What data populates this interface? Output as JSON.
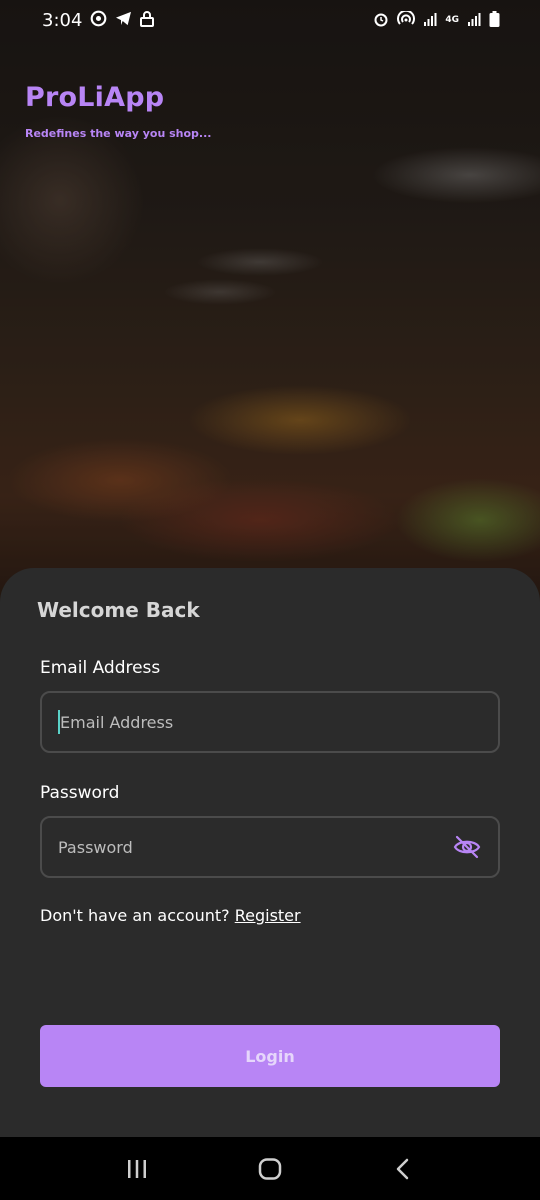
{
  "status_bar": {
    "time": "3:04",
    "left_icons": [
      "whatsapp-icon",
      "telegram-icon",
      "lock-icon"
    ],
    "right_icons": [
      "alarm-icon",
      "hotspot-icon",
      "signal-icon",
      "network-4g-icon",
      "signal-icon",
      "battery-icon"
    ],
    "network_label": "4G"
  },
  "brand": {
    "title": "ProLiApp",
    "tagline": "Redefines the way you shop...",
    "accent_color": "#b885f5"
  },
  "form": {
    "heading": "Welcome Back",
    "email": {
      "label": "Email Address",
      "placeholder": "Email Address",
      "value": ""
    },
    "password": {
      "label": "Password",
      "placeholder": "Password",
      "value": "",
      "toggle_icon": "eye-off-icon"
    },
    "register_prompt": "Don't have an account?",
    "register_link": "Register",
    "login_button": "Login"
  },
  "nav_bar": {
    "items": [
      "recents-icon",
      "home-icon",
      "back-icon"
    ]
  }
}
